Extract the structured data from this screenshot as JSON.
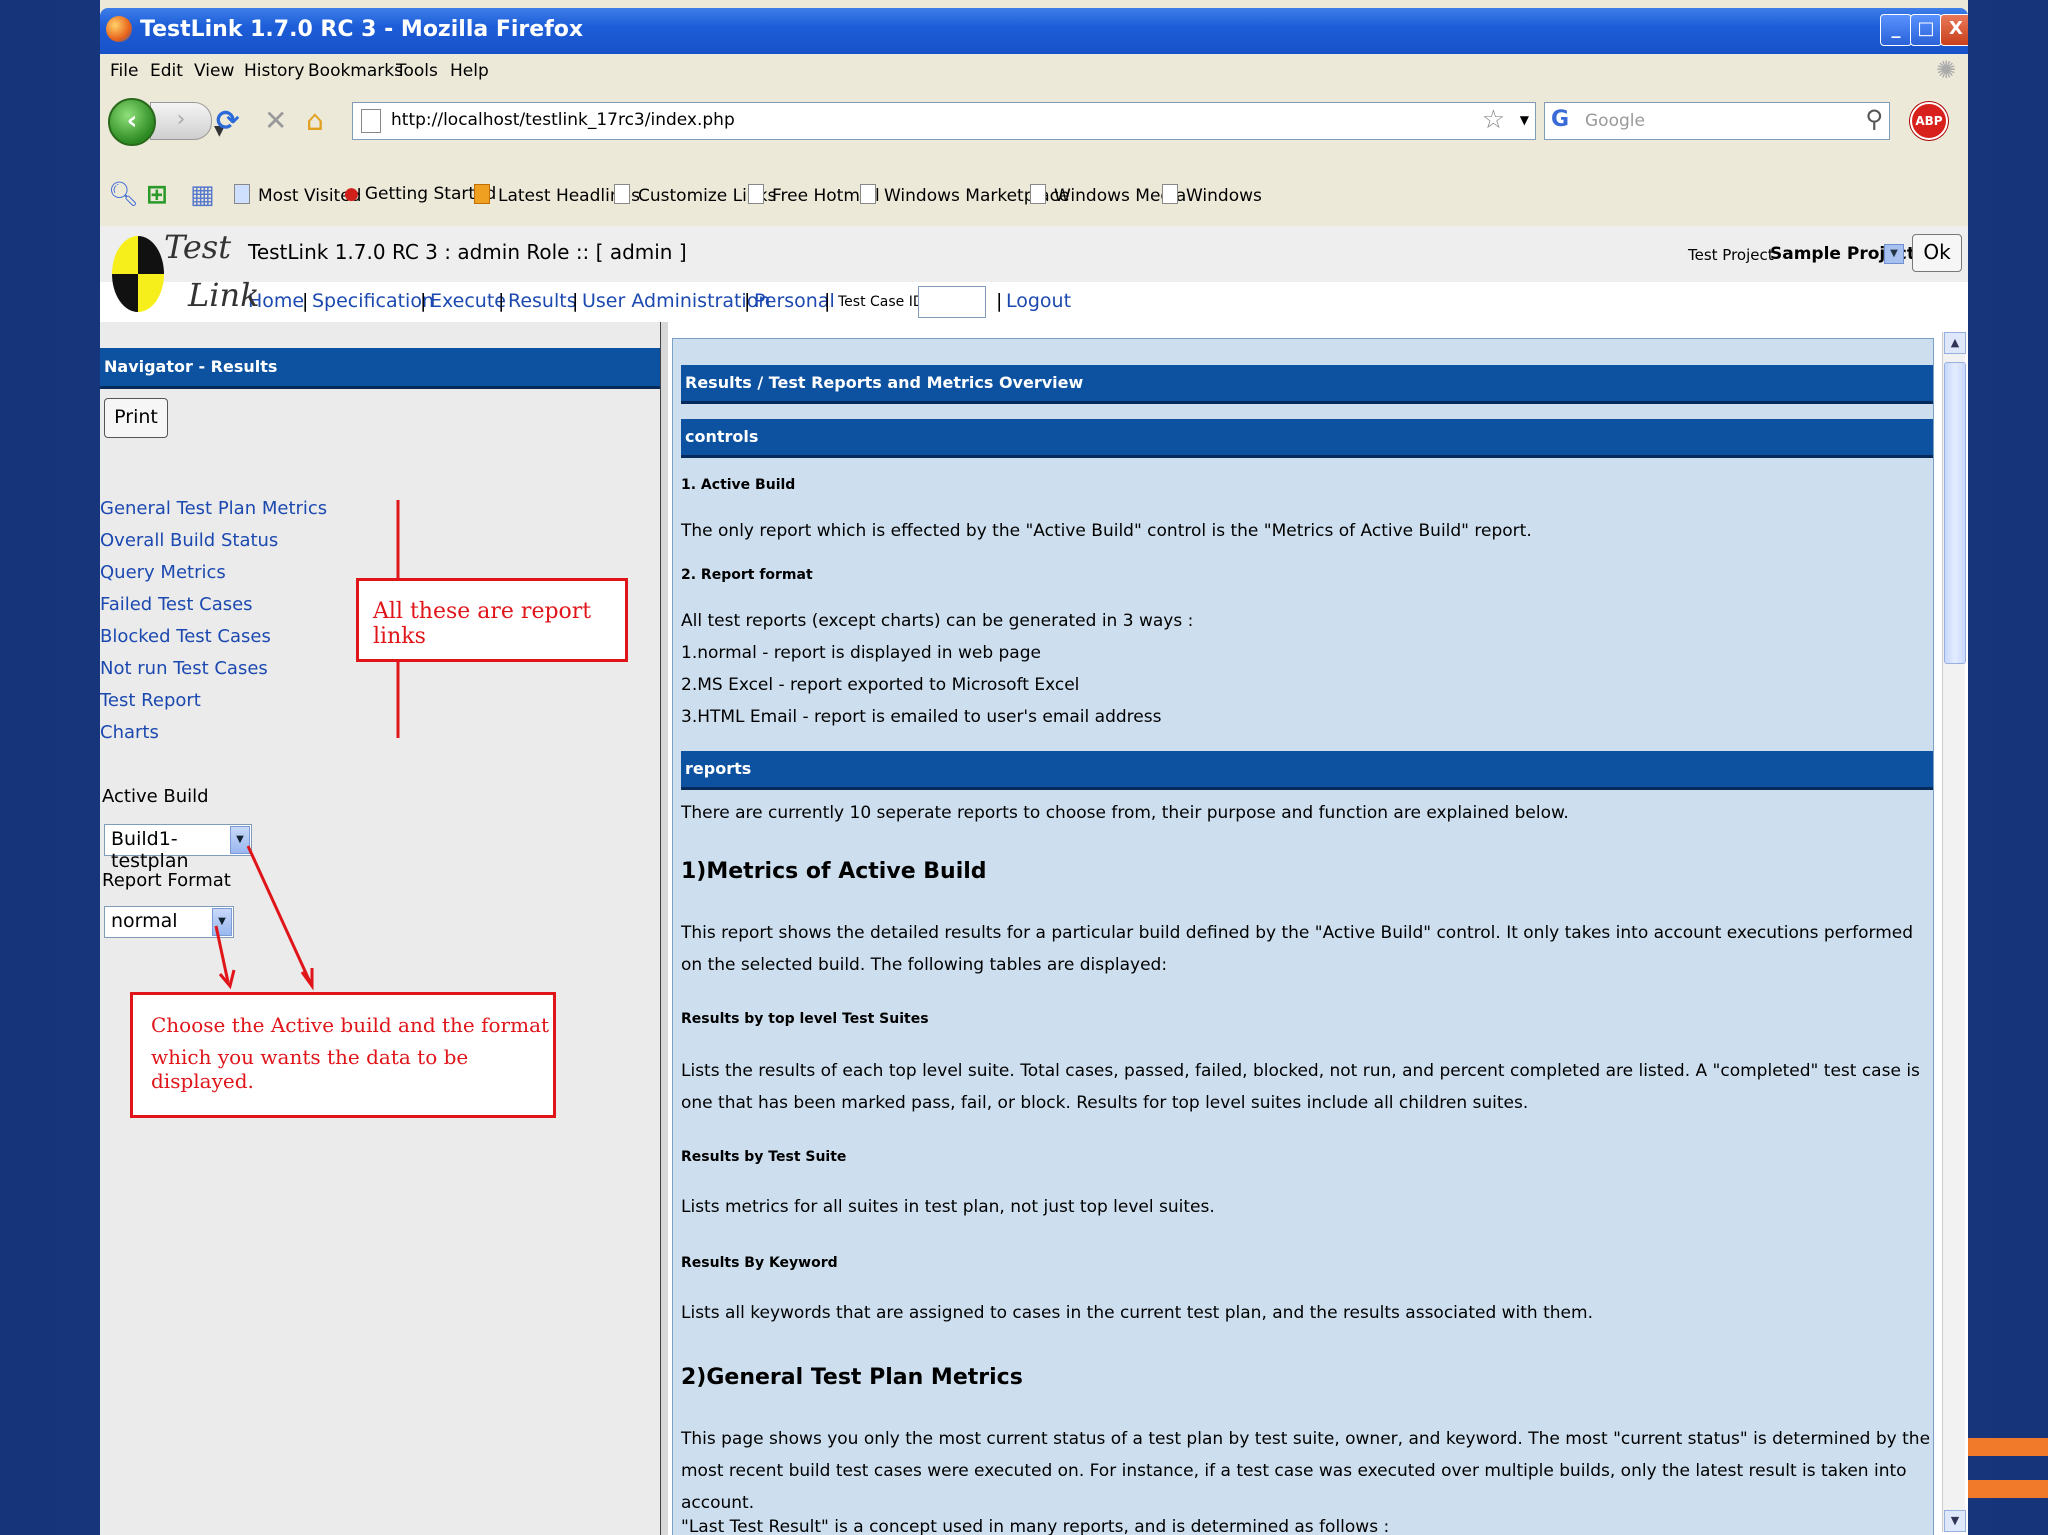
{
  "window": {
    "title": "TestLink 1.7.0 RC 3 - Mozilla Firefox",
    "controls": {
      "minimize": "_",
      "maximize": "□",
      "close": "X"
    }
  },
  "menu": [
    "File",
    "Edit",
    "View",
    "History",
    "Bookmarks",
    "Tools",
    "Help"
  ],
  "navbar": {
    "back": "‹",
    "forward": "›",
    "url": "http://localhost/testlink_17rc3/index.php",
    "search_engine": "G",
    "search_placeholder": "Google",
    "abp": "ABP"
  },
  "bookmarks": [
    "Most Visited",
    "Getting Started",
    "Latest Headlines",
    "Customize Links",
    "Free Hotmail",
    "Windows Marketplace",
    "Windows Media",
    "Windows"
  ],
  "testlink": {
    "logo_word1": "Test",
    "logo_word2": "Link",
    "title": "TestLink 1.7.0 RC 3 : admin Role :: [ admin ]",
    "test_project_label": "Test Project",
    "test_project_value": "Sample Project",
    "ok_label": "Ok",
    "menu": [
      "Home",
      "Specification",
      "Execute",
      "Results",
      "User Administration",
      "Personal"
    ],
    "test_case_id_label": "Test Case ID:",
    "logout": "Logout",
    "separator": "|"
  },
  "left_panel": {
    "header": "Navigator - Results",
    "print_label": "Print",
    "report_links": [
      "General Test Plan Metrics",
      "Overall Build Status",
      "Query Metrics",
      "Failed Test Cases",
      "Blocked Test Cases",
      "Not run Test Cases",
      "Test Report",
      "Charts"
    ],
    "active_build_label": "Active Build",
    "active_build_value": "Build1-testplan",
    "report_format_label": "Report Format",
    "report_format_value": "normal"
  },
  "annotations": {
    "links": "All these are report links",
    "build_line1": "Choose the Active build and the format",
    "build_line2": "which you wants the data to be displayed."
  },
  "right_panel": {
    "header": "Results / Test Reports and Metrics Overview",
    "controls_bar": "controls",
    "active_build_heading": "1. Active Build",
    "active_build_text": "The only report which is effected by the \"Active Build\" control is the \"Metrics of Active Build\" report.",
    "report_format_heading": "2. Report format",
    "report_format_intro": "All test reports (except charts) can be generated in 3 ways :",
    "report_format_ways": [
      "1.normal - report is displayed in web page",
      "2.MS Excel - report exported to Microsoft Excel",
      "3.HTML Email - report is emailed to user's email address"
    ],
    "reports_bar": "reports",
    "reports_intro": "There are currently 10 seperate reports to choose from, their purpose and function are explained below.",
    "metrics_heading": "1)Metrics of Active Build",
    "metrics_text": "This report shows the detailed results for a particular build defined by the \"Active Build\" control. It only takes into account executions performed on the selected build. The following tables are displayed:",
    "top_suites_heading": "Results by top level Test Suites",
    "top_suites_text": "Lists the results of each top level suite. Total cases, passed, failed, blocked, not run, and percent completed are listed. A \"completed\" test case is one that has been marked pass, fail, or block. Results for top level suites include all children suites.",
    "by_suite_heading": "Results by Test Suite",
    "by_suite_text": "Lists metrics for all suites in test plan, not just top level suites.",
    "by_keyword_heading": "Results By Keyword",
    "by_keyword_text": "Lists all keywords that are assigned to cases in the current test plan, and the results associated with them.",
    "general_heading": "2)General Test Plan Metrics",
    "general_text": "This page shows you only the most current status of a test plan by test suite, owner, and keyword. The most \"current status\" is determined by the most recent build test cases were executed on. For instance, if a test case was executed over multiple builds, only the latest result is taken into account.",
    "last_result_text": "\"Last Test Result\" is a concept used in many reports, and is determined as follows :"
  },
  "colors": {
    "header_bar": "#0c52a0",
    "link": "#1c49b0",
    "annotation": "#e0151a",
    "content_bg": "#cddfef"
  }
}
